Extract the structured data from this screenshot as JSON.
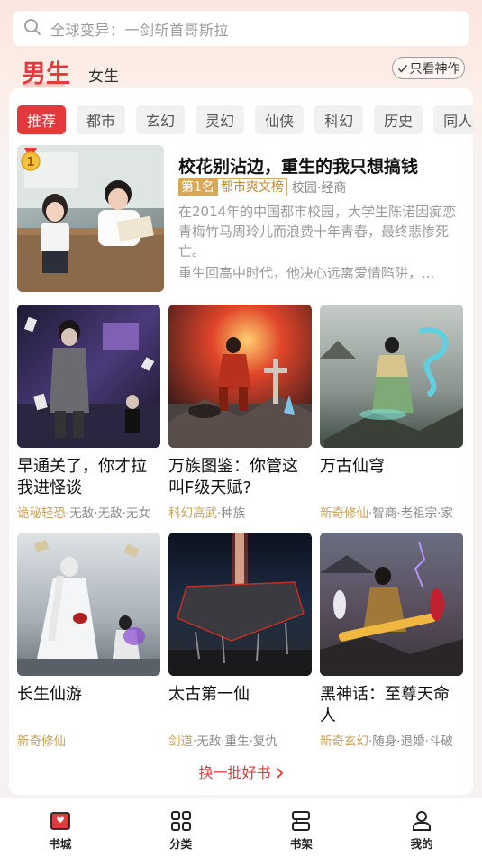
{
  "search": {
    "placeholder": "全球变异：一剑斩首哥斯拉"
  },
  "gender_tabs": {
    "male": "男生",
    "female": "女生"
  },
  "only_god_label": "只看神作",
  "categories": [
    "推荐",
    "都市",
    "玄幻",
    "灵幻",
    "仙侠",
    "科幻",
    "历史",
    "同人"
  ],
  "featured": {
    "badge": "1",
    "title": "校花别沾边，重生的我只想搞钱",
    "rank": "第1名",
    "rank_list": "都市爽文榜",
    "subgenre": "校园·经商",
    "desc1": "在2014年的中国都市校园，大学生陈诺因痴恋青梅竹马周玲儿而浪费十年青春，最终悲惨死亡。",
    "desc2": "重生回高中时代，他决心远离爱情陷阱，..."
  },
  "books": [
    {
      "title": "早通关了，你才拉我进怪谈",
      "tag_main": "诡秘轻恐",
      "tags_rest": "·无敌·无敌·无女"
    },
    {
      "title": "万族图鉴：你管这叫F级天赋?",
      "tag_main": "科幻高武",
      "tags_rest": "·种族"
    },
    {
      "title": "万古仙穹",
      "tag_main": "新奇修仙",
      "tags_rest": "·智商·老祖宗·家"
    },
    {
      "title": "长生仙游",
      "tag_main": "新奇修仙",
      "tags_rest": ""
    },
    {
      "title": "太古第一仙",
      "tag_main": "剑道",
      "tags_rest": "·无敌·重生·复仇"
    },
    {
      "title": "黑神话：至尊天命人",
      "tag_main": "新奇玄幻",
      "tags_rest": "·随身·退婚·斗破"
    }
  ],
  "more_label": "换一批好书",
  "bottom_nav": [
    {
      "label": "书城",
      "icon": "bookstore-icon"
    },
    {
      "label": "分类",
      "icon": "grid-icon"
    },
    {
      "label": "书架",
      "icon": "bookshelf-icon"
    },
    {
      "label": "我的",
      "icon": "person-icon"
    }
  ],
  "colors": {
    "accent": "#e4393c",
    "tag_gold": "#c9a05a",
    "rank_gold": "#d7a85a"
  }
}
